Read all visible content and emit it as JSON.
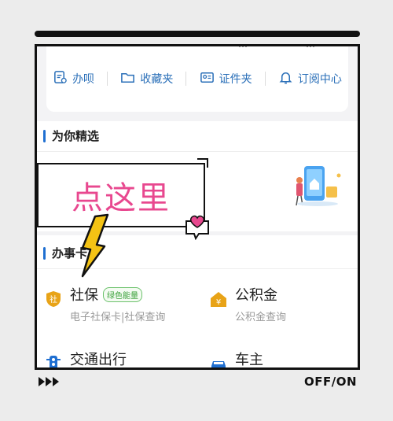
{
  "top_card": {
    "cut_left": "…",
    "cut_right": "…",
    "quick_links": [
      {
        "label": "办呗",
        "icon": "ticket-icon"
      },
      {
        "label": "收藏夹",
        "icon": "folder-icon"
      },
      {
        "label": "证件夹",
        "icon": "id-card-icon"
      },
      {
        "label": "订阅中心",
        "icon": "bell-icon"
      }
    ]
  },
  "sections": {
    "picks_title": "为你精选",
    "services_title": "办事卡"
  },
  "callout": {
    "text": "点这里"
  },
  "services": [
    {
      "title": "社保",
      "tag": "绿色能量",
      "subtitle": "电子社保卡|社保查询",
      "icon": "shield-badge-icon",
      "icon_color": "#e8a317"
    },
    {
      "title": "公积金",
      "tag": "",
      "subtitle": "公积金查询",
      "icon": "house-yen-icon",
      "icon_color": "#e8a317"
    },
    {
      "title": "交通出行",
      "tag": "",
      "subtitle": "",
      "icon": "traffic-light-icon",
      "icon_color": "#1f6fd1"
    },
    {
      "title": "车主",
      "tag": "",
      "subtitle": "",
      "icon": "car-icon",
      "icon_color": "#1f6fd1"
    }
  ],
  "player": {
    "status": "OFF/ON",
    "icon": "fast-forward-icon"
  },
  "colors": {
    "accent": "#1f6fd1",
    "callout_pink": "#e8488f",
    "arrow_yellow": "#f4c314"
  }
}
